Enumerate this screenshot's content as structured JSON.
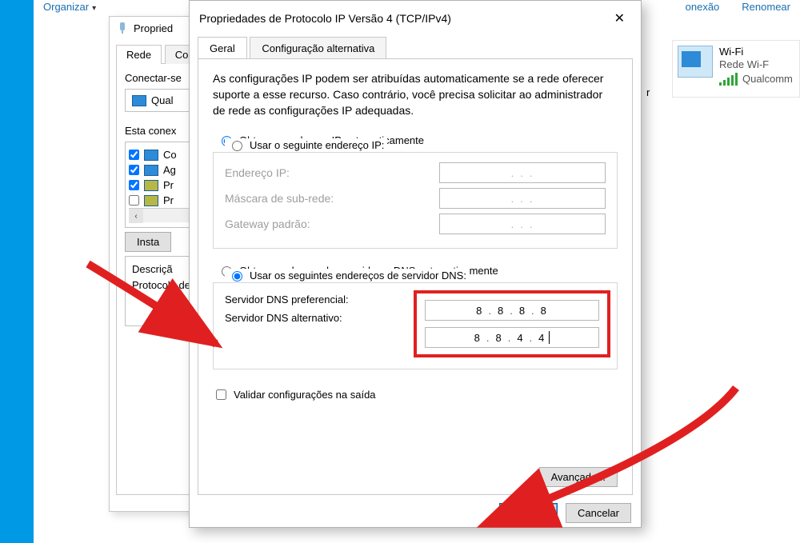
{
  "toolbar": {
    "organize": "Organizar",
    "connection_cut": "onexão",
    "rename": "Renomear"
  },
  "wifi": {
    "name": "Wi-Fi",
    "net": "Rede Wi-F",
    "adapter": "Qualcomm"
  },
  "propwin": {
    "title": "Propried",
    "tab_rede": "Rede",
    "tab_com": "Com",
    "connect_label": "Conectar-se",
    "qual": "Qual",
    "items_label": "Esta conex",
    "items": [
      "Co",
      "Ag",
      "Pr",
      "Pr"
    ],
    "install": "Insta",
    "desc_title": "Descriçã",
    "desc_body": "Protocolo de rede entre div"
  },
  "dialog": {
    "title": "Propriedades de Protocolo IP Versão 4 (TCP/IPv4)",
    "close": "✕",
    "tab_general": "Geral",
    "tab_alt": "Configuração alternativa",
    "info": "As configurações IP podem ser atribuídas automaticamente se a rede oferecer suporte a esse recurso. Caso contrário, você precisa solicitar ao administrador de rede as configurações IP adequadas.",
    "radio_ip_auto": "Obter um endereço IP automaticamente",
    "radio_ip_manual": "Usar o seguinte endereço IP:",
    "lbl_ip": "Endereço IP:",
    "lbl_mask": "Máscara de sub-rede:",
    "lbl_gw": "Gateway padrão:",
    "radio_dns_auto": "Obter o endereço dos servidores DNS automaticamente",
    "radio_dns_manual": "Usar os seguintes endereços de servidor DNS:",
    "lbl_dns1": "Servidor DNS preferencial:",
    "lbl_dns2": "Servidor DNS alternativo:",
    "dns1": {
      "a": "8",
      "b": "8",
      "c": "8",
      "d": "8"
    },
    "dns2": {
      "a": "8",
      "b": "8",
      "c": "4",
      "d": "4"
    },
    "validate": "Validar configurações na saída",
    "advanced": "Avançado...",
    "ok": "OK",
    "cancel": "Cancelar"
  },
  "partial_r": "r"
}
